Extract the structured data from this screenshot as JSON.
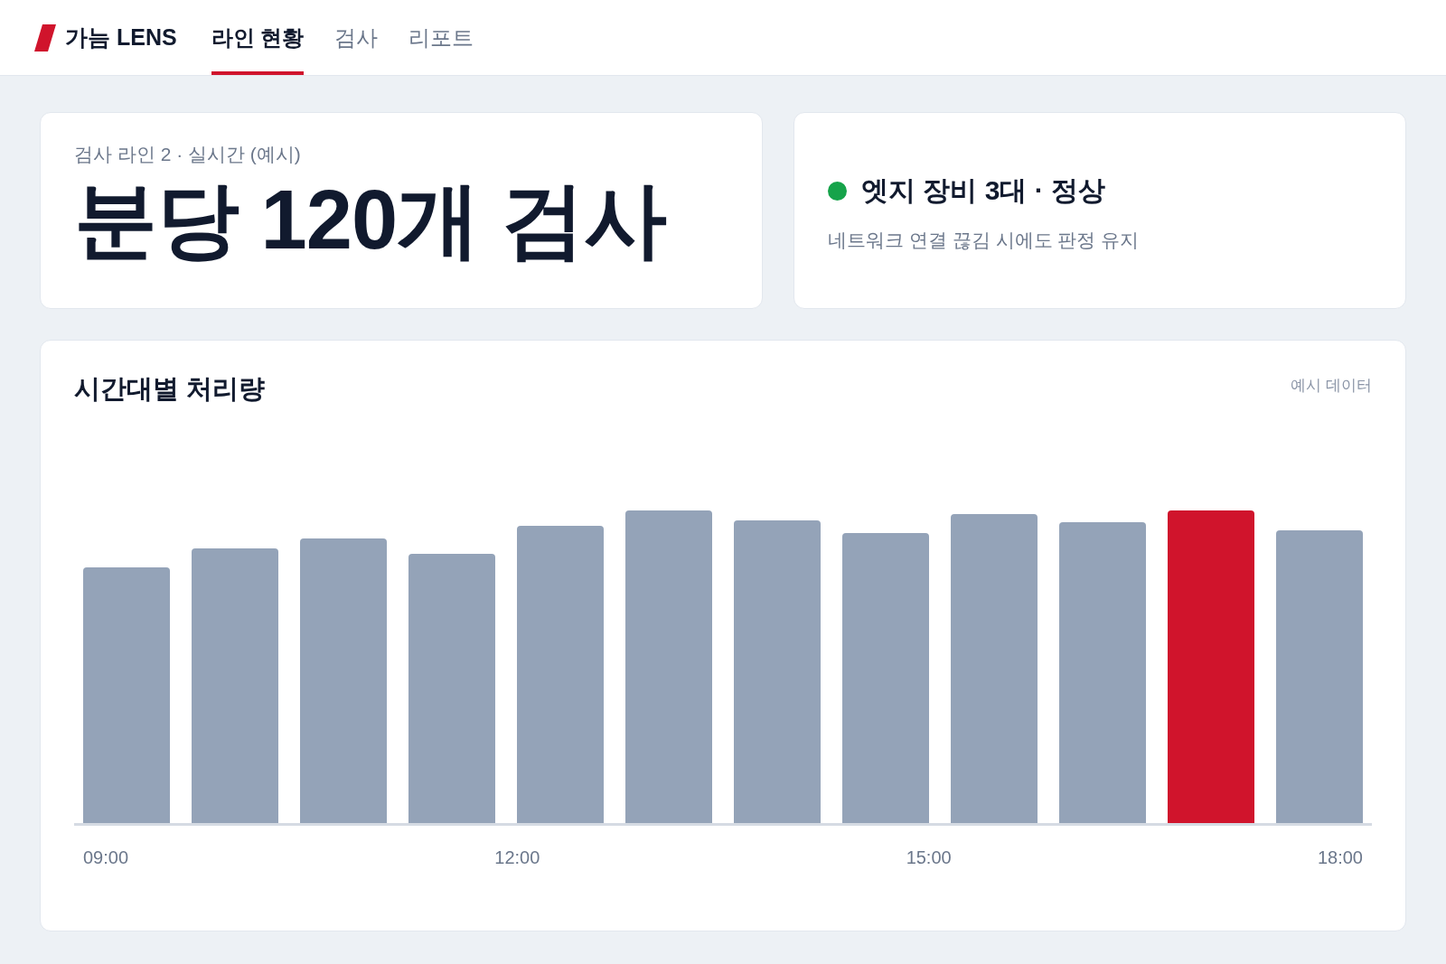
{
  "brand": {
    "name": "가늠 LENS"
  },
  "tabs": [
    {
      "label": "라인 현황",
      "selected": true
    },
    {
      "label": "검사",
      "selected": false
    },
    {
      "label": "리포트",
      "selected": false
    }
  ],
  "summary": {
    "caption": "검사 라인 2 · 실시간 (예시)",
    "headline": "분당 120개 검사"
  },
  "status": {
    "title": "엣지 장비 3대 · 정상",
    "color": "#16a34a",
    "note": "네트워크 연결 끊김 시에도 판정 유지"
  },
  "throughput": {
    "title": "시간대별 처리량",
    "tag": "예시 데이터",
    "bars": [
      {
        "selected": false
      },
      {
        "selected": false
      },
      {
        "selected": false
      },
      {
        "selected": false
      },
      {
        "selected": false
      },
      {
        "selected": false
      },
      {
        "selected": false
      },
      {
        "selected": false
      },
      {
        "selected": false
      },
      {
        "selected": false
      },
      {
        "selected": true
      },
      {
        "selected": false
      }
    ],
    "x_labels": [
      "09:00",
      "12:00",
      "15:00",
      "18:00"
    ]
  }
}
